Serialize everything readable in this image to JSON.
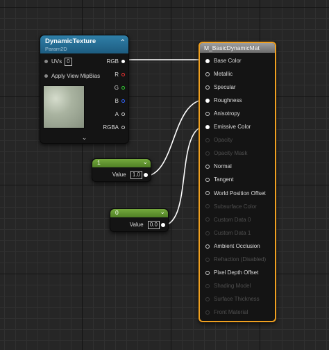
{
  "texture_node": {
    "title": "DynamicTexture",
    "subtitle": "Param2D",
    "uvs_label": "UVs",
    "uvs_value": "0",
    "apply_view_mipbias_label": "Apply View MipBias",
    "outputs": [
      "RGB",
      "R",
      "G",
      "B",
      "A",
      "RGBA"
    ],
    "expand_icon": "chevron-down-icon"
  },
  "constant_1": {
    "title": "1",
    "value_label": "Value",
    "value": "1.0"
  },
  "constant_0": {
    "title": "0",
    "value_label": "Value",
    "value": "0.0"
  },
  "material_node": {
    "title": "M_BasicDynamicMat",
    "inputs": [
      {
        "label": "Base Color",
        "enabled": true,
        "connected": true
      },
      {
        "label": "Metallic",
        "enabled": true,
        "connected": false
      },
      {
        "label": "Specular",
        "enabled": true,
        "connected": false
      },
      {
        "label": "Roughness",
        "enabled": true,
        "connected": true
      },
      {
        "label": "Anisotropy",
        "enabled": true,
        "connected": false
      },
      {
        "label": "Emissive Color",
        "enabled": true,
        "connected": true
      },
      {
        "label": "Opacity",
        "enabled": false,
        "connected": false
      },
      {
        "label": "Opacity Mask",
        "enabled": false,
        "connected": false
      },
      {
        "label": "Normal",
        "enabled": true,
        "connected": false
      },
      {
        "label": "Tangent",
        "enabled": true,
        "connected": false
      },
      {
        "label": "World Position Offset",
        "enabled": true,
        "connected": false
      },
      {
        "label": "Subsurface Color",
        "enabled": false,
        "connected": false
      },
      {
        "label": "Custom Data 0",
        "enabled": false,
        "connected": false
      },
      {
        "label": "Custom Data 1",
        "enabled": false,
        "connected": false
      },
      {
        "label": "Ambient Occlusion",
        "enabled": true,
        "connected": false
      },
      {
        "label": "Refraction (Disabled)",
        "enabled": false,
        "connected": false
      },
      {
        "label": "Pixel Depth Offset",
        "enabled": true,
        "connected": false
      },
      {
        "label": "Shading Model",
        "enabled": false,
        "connected": false
      },
      {
        "label": "Surface Thickness",
        "enabled": false,
        "connected": false
      },
      {
        "label": "Front Material",
        "enabled": false,
        "connected": false
      }
    ]
  },
  "colors": {
    "material_border": "#f0a020",
    "texture_header": "#2f7fa8",
    "constant_header": "#74a83c",
    "wire": "#ffffff"
  }
}
